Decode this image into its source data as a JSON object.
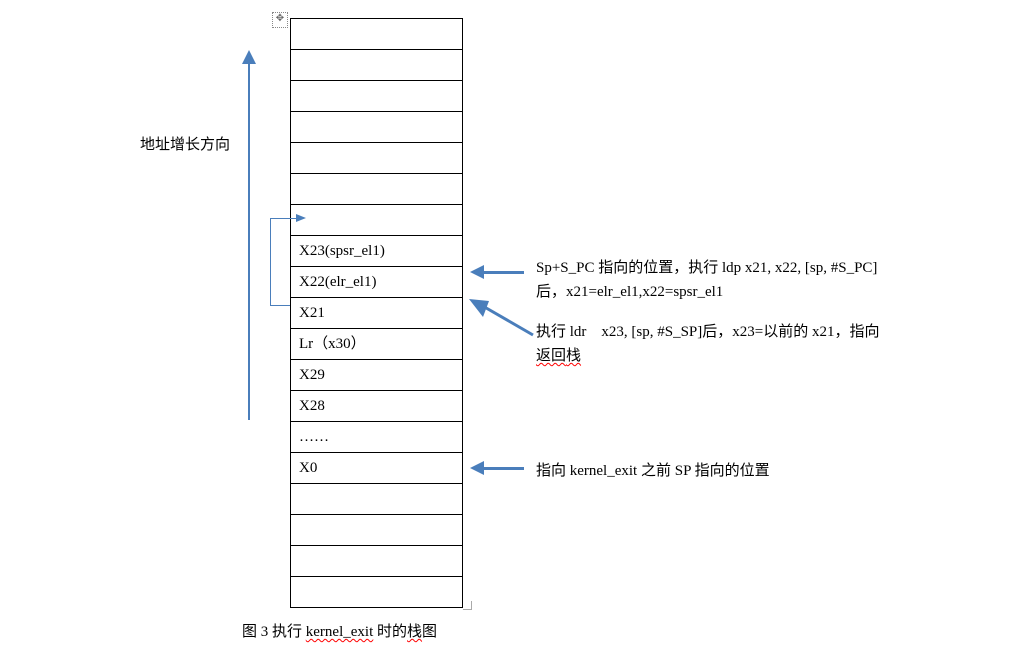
{
  "diagram": {
    "caption_prefix": "图 3  执行 ",
    "caption_wavy1": "kernel_exit",
    "caption_mid": " 时的",
    "caption_wavy2": "栈",
    "caption_suffix": "图",
    "growth_label": "地址增长方向",
    "cells": [
      "",
      "",
      "",
      "",
      "",
      "",
      "",
      "X23(spsr_el1)",
      "X22(elr_el1)",
      "X21",
      "Lr（x30）",
      "X29",
      "X28",
      "……",
      "X0",
      "",
      "",
      "",
      ""
    ],
    "note1_line1": "Sp+S_PC 指向的位置，执行 ldp x21, x22, [sp, #S_PC]",
    "note1_line2": "后，x21=elr_el1,x22=spsr_el1",
    "note2_line1": "执行 ldr    x23, [sp, #S_SP]后，x23=以前的 x21，指向",
    "note2_line2": "返回栈",
    "note3": "指向 kernel_exit 之前 SP 指向的位置"
  }
}
